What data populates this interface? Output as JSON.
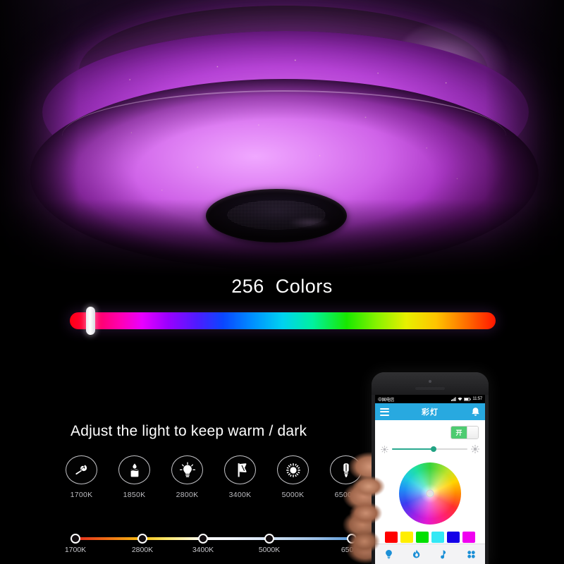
{
  "hero": {
    "product": "RGB bluetooth music LED ceiling lamp",
    "lamp_color": "#d069e8",
    "speaker_label": "bluetooth-speaker-grille"
  },
  "colors_section": {
    "title": "256  Colors",
    "slider": {
      "name": "rgb-color-slider",
      "thumb_position_percent": 4,
      "gradient_stops": [
        "#ff0010",
        "#ff00b4",
        "#9b00ff",
        "#0a46ff",
        "#00d2f0",
        "#18e800",
        "#e8f000",
        "#ffc400",
        "#ff1500"
      ]
    }
  },
  "warm_section": {
    "title": "Adjust the light to keep warm / dark",
    "kelvin_presets": [
      {
        "label": "1700K",
        "icon": "match-flame-icon"
      },
      {
        "label": "1850K",
        "icon": "candle-icon"
      },
      {
        "label": "2800K",
        "icon": "incandescent-bulb-icon"
      },
      {
        "label": "3400K",
        "icon": "spotlight-icon"
      },
      {
        "label": "5000K",
        "icon": "sun-icon"
      },
      {
        "label": "6500K",
        "icon": "led-tube-bulb-icon"
      }
    ],
    "kelvin_scale": {
      "name": "color-temperature-slider",
      "nodes": [
        {
          "label": "1700K",
          "position_percent": 0,
          "color": "#e22020"
        },
        {
          "label": "2800K",
          "position_percent": 25,
          "color": "#f5c014"
        },
        {
          "label": "3400K",
          "position_percent": 46,
          "color": "#ffffff"
        },
        {
          "label": "5000K",
          "position_percent": 70,
          "color": "#cfe0f3"
        },
        {
          "label": "6500K",
          "position_percent": 100,
          "color": "#4a8fd4"
        }
      ],
      "gradient": [
        "#e22020",
        "#ef6a16",
        "#f5c014",
        "#ffffff",
        "#cfe0f3",
        "#4a8fd4"
      ]
    }
  },
  "phone": {
    "status_bar": {
      "carrier": "中国电信",
      "time": "11:57",
      "icons": "signal-wifi-battery"
    },
    "app_header": {
      "menu_icon": "hamburger-menu-icon",
      "title": "彩灯",
      "notification_icon": "bell-icon",
      "accent_color": "#28a9e0"
    },
    "power_toggle": {
      "label": "开",
      "state": "on",
      "color": "#4ecb71"
    },
    "brightness_slider": {
      "value_percent": 55,
      "fill_color": "#2aa98f",
      "left_icon": "dim-brightness-icon",
      "right_icon": "high-brightness-icon"
    },
    "color_wheel": {
      "name": "color-wheel-picker",
      "selected_marker": "center"
    },
    "swatches": [
      {
        "name": "swatch-red",
        "color": "#ff0000"
      },
      {
        "name": "swatch-yellow",
        "color": "#ffee00"
      },
      {
        "name": "swatch-green",
        "color": "#00e000"
      },
      {
        "name": "swatch-cyan",
        "color": "#33e8f5"
      },
      {
        "name": "swatch-blue",
        "color": "#1500e8"
      },
      {
        "name": "swatch-magenta",
        "color": "#f000f0"
      }
    ],
    "tabs": [
      {
        "name": "tab-light",
        "icon": "bulb-icon"
      },
      {
        "name": "tab-scene",
        "icon": "flame-icon"
      },
      {
        "name": "tab-music",
        "icon": "music-note-icon"
      },
      {
        "name": "tab-more",
        "icon": "grid-icon"
      }
    ]
  }
}
